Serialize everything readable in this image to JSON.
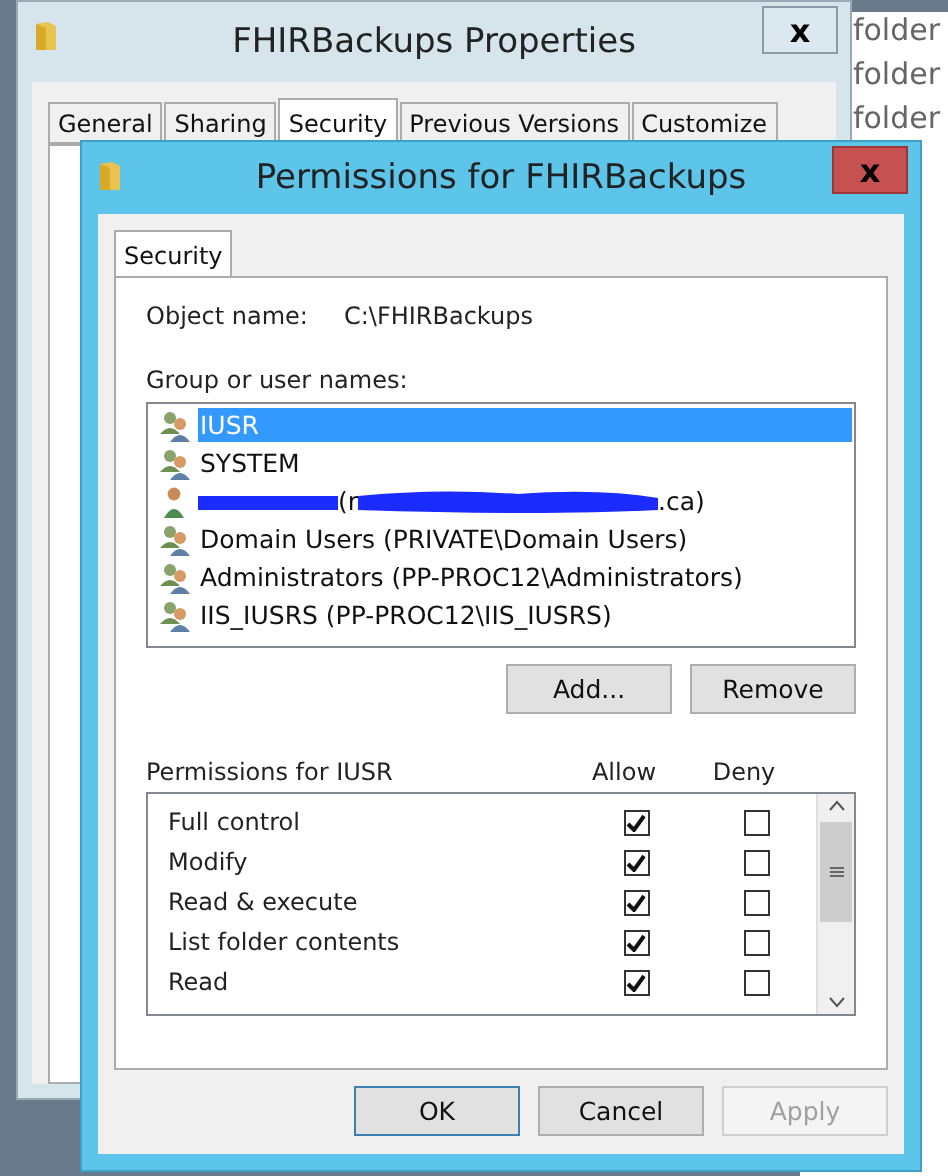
{
  "background_list": [
    "folder",
    "folder",
    "folder"
  ],
  "properties_window": {
    "title": "FHIRBackups Properties",
    "close": "x",
    "tabs": [
      {
        "label": "General",
        "selected": false
      },
      {
        "label": "Sharing",
        "selected": false
      },
      {
        "label": "Security",
        "selected": true
      },
      {
        "label": "Previous Versions",
        "selected": false
      },
      {
        "label": "Customize",
        "selected": false
      }
    ]
  },
  "permissions_window": {
    "title": "Permissions for FHIRBackups",
    "close": "x",
    "tabs": [
      {
        "label": "Security",
        "selected": true
      }
    ],
    "object_name_label": "Object name:",
    "object_name": "C:\\FHIRBackups",
    "group_label": "Group or user names:",
    "users": [
      {
        "kind": "group",
        "name": "IUSR",
        "selected": true
      },
      {
        "kind": "group",
        "name": "SYSTEM",
        "selected": false
      },
      {
        "kind": "redacted",
        "name": "(r",
        "suffix": ".ca)",
        "selected": false
      },
      {
        "kind": "group",
        "name": "Domain Users (PRIVATE\\Domain Users)",
        "selected": false
      },
      {
        "kind": "group",
        "name": "Administrators (PP-PROC12\\Administrators)",
        "selected": false
      },
      {
        "kind": "group",
        "name": "IIS_IUSRS (PP-PROC12\\IIS_IUSRS)",
        "selected": false
      }
    ],
    "user_buttons": [
      "Add...",
      "Remove"
    ],
    "permissions_label": "Permissions for IUSR",
    "allow_label": "Allow",
    "deny_label": "Deny",
    "permissions": [
      {
        "name": "Full control",
        "allow": true,
        "deny": false
      },
      {
        "name": "Modify",
        "allow": true,
        "deny": false
      },
      {
        "name": "Read & execute",
        "allow": true,
        "deny": false
      },
      {
        "name": "List folder contents",
        "allow": true,
        "deny": false
      },
      {
        "name": "Read",
        "allow": true,
        "deny": false
      }
    ],
    "buttons": [
      {
        "label": "OK",
        "disabled": false,
        "default": true
      },
      {
        "label": "Cancel",
        "disabled": false,
        "default": false
      },
      {
        "label": "Apply",
        "disabled": true,
        "default": false
      }
    ]
  }
}
